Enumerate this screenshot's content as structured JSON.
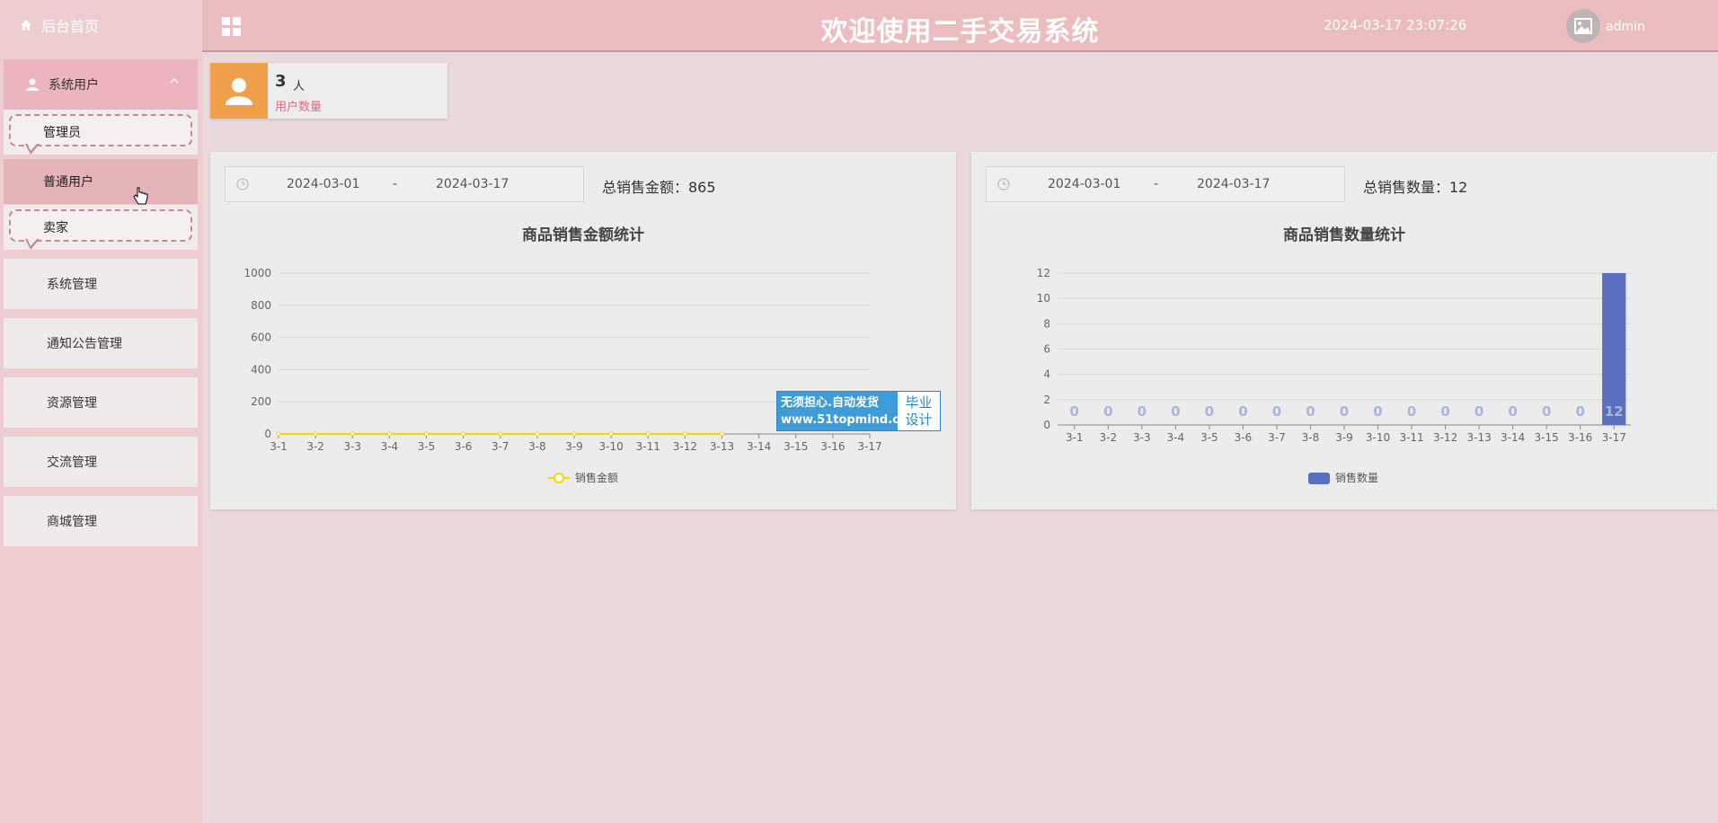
{
  "sidebar": {
    "home_label": "后台首页",
    "group_label": "系统用户",
    "sub_items": [
      "管理员",
      "普通用户",
      "卖家"
    ],
    "nav_items": [
      "系统管理",
      "通知公告管理",
      "资源管理",
      "交流管理",
      "商城管理"
    ]
  },
  "header": {
    "title": "欢迎使用二手交易系统",
    "datetime": "2024-03-17 23:07:26",
    "user": "admin"
  },
  "stat": {
    "value": "3",
    "unit": "人",
    "label": "用户数量"
  },
  "left_panel": {
    "start_date": "2024-03-01",
    "separator": "-",
    "end_date": "2024-03-17",
    "total_label": "总销售金额：865"
  },
  "right_panel": {
    "start_date": "2024-03-01",
    "separator": "-",
    "end_date": "2024-03-17",
    "total_label": "总销售数量：12"
  },
  "watermark": {
    "line1": "无须担心.自动发货",
    "line2": "www.51topmind.com",
    "right1": "毕业",
    "right2": "设计"
  },
  "colors": {
    "line_series": "#f2d600",
    "bar_series": "#5b6fc0",
    "stat_icon_bg": "#f0a04b",
    "header_bg": "#ecbdbe"
  },
  "chart_data": [
    {
      "type": "line",
      "title": "商品销售金额统计",
      "categories": [
        "3-1",
        "3-2",
        "3-3",
        "3-4",
        "3-5",
        "3-6",
        "3-7",
        "3-8",
        "3-9",
        "3-10",
        "3-11",
        "3-12",
        "3-13",
        "3-14",
        "3-15",
        "3-16",
        "3-17"
      ],
      "series": [
        {
          "name": "销售金额",
          "values": [
            0,
            0,
            0,
            0,
            0,
            0,
            0,
            0,
            0,
            0,
            0,
            0,
            0,
            null,
            null,
            null,
            null
          ]
        }
      ],
      "yticks": [
        0,
        200,
        400,
        600,
        800,
        1000
      ],
      "ylim": [
        0,
        1000
      ],
      "grid": true,
      "legend": "bottom-center"
    },
    {
      "type": "bar",
      "title": "商品销售数量统计",
      "categories": [
        "3-1",
        "3-2",
        "3-3",
        "3-4",
        "3-5",
        "3-6",
        "3-7",
        "3-8",
        "3-9",
        "3-10",
        "3-11",
        "3-12",
        "3-13",
        "3-14",
        "3-15",
        "3-16",
        "3-17"
      ],
      "series": [
        {
          "name": "销售数量",
          "values": [
            0,
            0,
            0,
            0,
            0,
            0,
            0,
            0,
            0,
            0,
            0,
            0,
            0,
            0,
            0,
            0,
            12
          ]
        }
      ],
      "yticks": [
        0,
        2,
        4,
        6,
        8,
        10,
        12
      ],
      "ylim": [
        0,
        12
      ],
      "grid": true,
      "legend": "bottom-center"
    }
  ]
}
